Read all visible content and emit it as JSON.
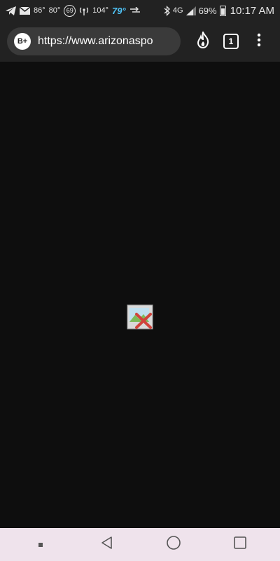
{
  "status_bar": {
    "temp_1": "86°",
    "temp_2": "80°",
    "badge": "69",
    "temp_3": "104°",
    "temp_4": "79°",
    "network": "4G",
    "battery": "69%",
    "time": "10:17 AM"
  },
  "toolbar": {
    "site_badge": "B+",
    "url": "https://www.arizonaspo",
    "tabs_count": "1"
  },
  "icons": {
    "status": [
      "telegram-icon",
      "mail-icon",
      "hotspot-icon",
      "arrows-icon",
      "bluetooth-icon",
      "signal-icon",
      "battery-icon"
    ],
    "toolbar": [
      "flame-icon",
      "tabs-icon",
      "menu-icon"
    ],
    "nav": [
      "recent-dot-icon",
      "back-icon",
      "home-icon",
      "overview-icon"
    ]
  }
}
